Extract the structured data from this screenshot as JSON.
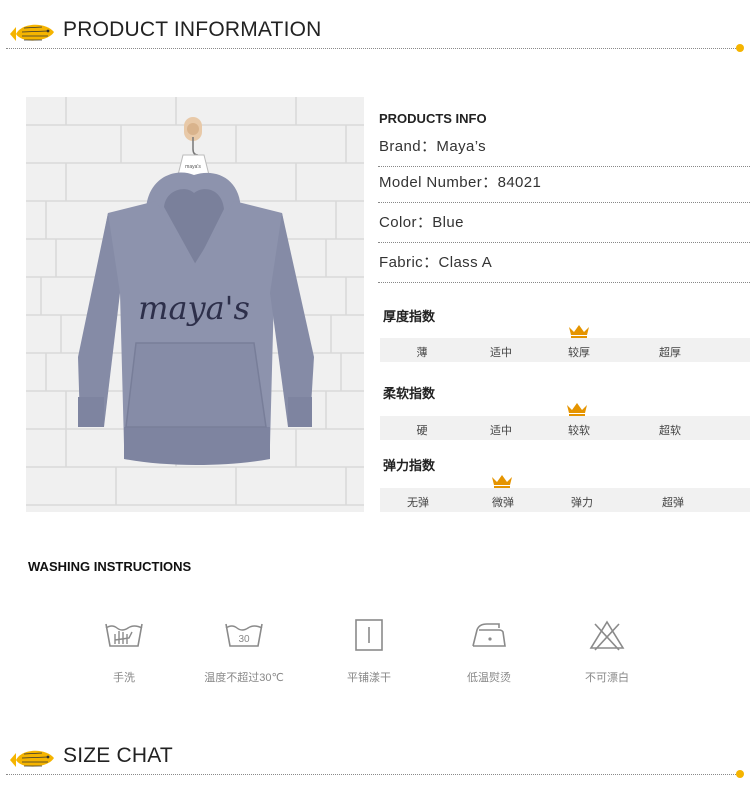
{
  "headers": {
    "product": "PRODUCT INFORMATION",
    "size": "SIZE CHAT"
  },
  "product_info": {
    "title": "PRODUCTS INFO",
    "rows": [
      "Brand：Maya’s",
      "Model Number：84021",
      "Color：Blue",
      "Fabric：Class A"
    ]
  },
  "photo": {
    "garment_text": "maya's",
    "tag_text": "maya's"
  },
  "scales": [
    {
      "label": "厚度指数",
      "options": [
        "薄",
        "适中",
        "较厚",
        "超厚"
      ],
      "selected_index": 2
    },
    {
      "label": "柔软指数",
      "options": [
        "硬",
        "适中",
        "较软",
        "超软"
      ],
      "selected_index": 2
    },
    {
      "label": "弹力指数",
      "options": [
        "无弹",
        "微弹",
        "弹力",
        "超弹"
      ],
      "selected_index": 1
    }
  ],
  "washing": {
    "title": "WASHING INSTRUCTIONS",
    "items": [
      {
        "icon": "hand-wash-icon",
        "label": "手洗"
      },
      {
        "icon": "wash-30-icon",
        "label": "温度不超过30℃",
        "temp": "30"
      },
      {
        "icon": "dry-flat-icon",
        "label": "平铺漾干"
      },
      {
        "icon": "iron-low-icon",
        "label": "低温熨烫"
      },
      {
        "icon": "no-bleach-icon",
        "label": "不可漂白"
      }
    ]
  },
  "colors": {
    "accent_yellow": "#f5b400",
    "crown_orange": "#e59400",
    "hoodie_blue": "#8d93ad",
    "icon_gray": "#8a8a8a"
  }
}
